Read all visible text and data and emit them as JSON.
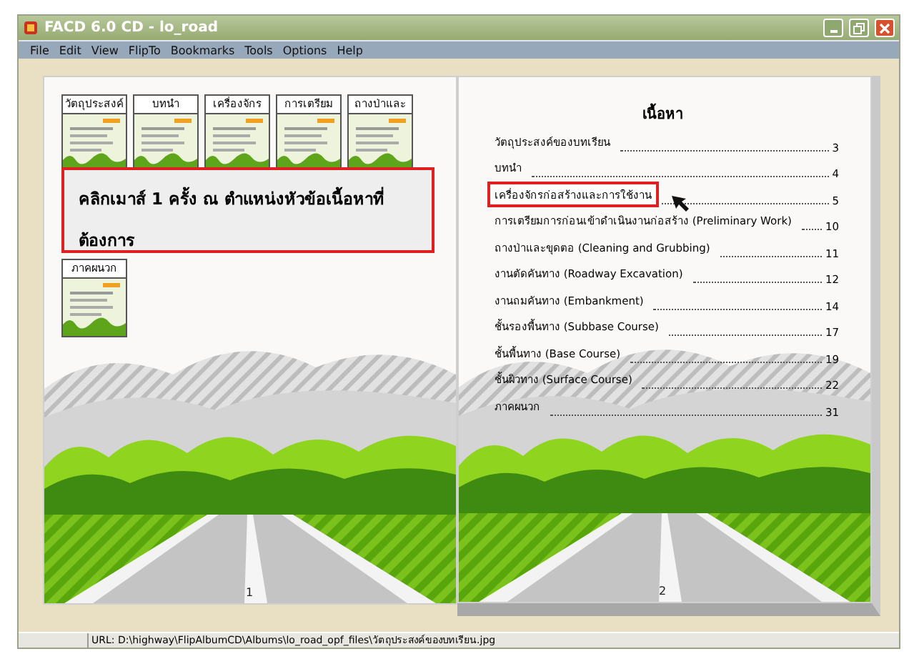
{
  "window": {
    "title": "FACD 6.0 CD - lo_road"
  },
  "menu": [
    "File",
    "Edit",
    "View",
    "FlipTo",
    "Bookmarks",
    "Tools",
    "Options",
    "Help"
  ],
  "left_page": {
    "thumbnails": [
      {
        "label": "วัตถุประสงค์"
      },
      {
        "label": "บทนำ"
      },
      {
        "label": "เครื่องจักร"
      },
      {
        "label": "การเตรียม"
      },
      {
        "label": "ถางป่าและ"
      },
      {
        "label": "ภาคผนวก"
      }
    ],
    "callout": "คลิกเมาส์ 1 ครั้ง ณ ตำแหน่งหัวข้อเนื้อหาที่ต้องการ",
    "page_number": "1"
  },
  "right_page": {
    "title": "เนื้อหา",
    "entries": [
      {
        "text": "วัตถุประสงค์ของบทเรียน",
        "page": "3",
        "highlighted": false
      },
      {
        "text": "บทนำ",
        "page": "4",
        "highlighted": false
      },
      {
        "text": "เครื่องจักรก่อสร้างและการใช้งาน",
        "page": "5",
        "highlighted": true
      },
      {
        "text": "การเตรียมการก่อนเข้าดำเนินงานก่อสร้าง (Preliminary Work)",
        "page": "10",
        "highlighted": false
      },
      {
        "text": "ถางป่าและขุดตอ (Cleaning and Grubbing)",
        "page": "11",
        "highlighted": false
      },
      {
        "text": "งานตัดคันทาง (Roadway Excavation)",
        "page": "12",
        "highlighted": false
      },
      {
        "text": "งานถมคันทาง (Embankment)",
        "page": "14",
        "highlighted": false
      },
      {
        "text": "ชั้นรองพื้นทาง (Subbase Course)",
        "page": "17",
        "highlighted": false
      },
      {
        "text": "ชั้นพื้นทาง (Base Course)",
        "page": "19",
        "highlighted": false
      },
      {
        "text": "ชั้นผิวทาง (Surface Course)",
        "page": "22",
        "highlighted": false
      },
      {
        "text": "ภาคผนวก",
        "page": "31",
        "highlighted": false
      }
    ],
    "page_number": "2"
  },
  "status_bar": {
    "url": "URL: D:\\highway\\FlipAlbumCD\\Albums\\lo_road_opf_files\\วัตถุประสงค์ของบทเรียน.jpg"
  }
}
